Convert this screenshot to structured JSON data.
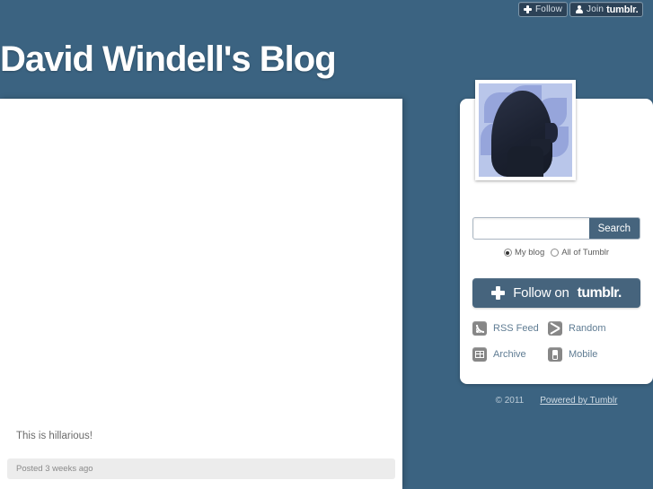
{
  "theme": {
    "background_color": "#3b6381",
    "accent_color": "#46647d",
    "panel_color": "#ffffff",
    "link_color": "#5f7c93"
  },
  "tumblr_bar": {
    "follow_button": {
      "label": "Follow",
      "icon": "plus-icon"
    },
    "join_button": {
      "label": "Join",
      "brand": "tumblr.",
      "icon": "person-icon"
    }
  },
  "header": {
    "title": "David Windell's Blog"
  },
  "main": {
    "post": {
      "photo_alt": "",
      "caption": "This is hillarious!",
      "meta": "Posted 3 weeks ago"
    }
  },
  "sidebar": {
    "avatar": {
      "icon": "avatar-head-silhouette"
    },
    "search": {
      "value": "",
      "placeholder": "",
      "button_label": "Search",
      "scopes": [
        {
          "label": "My blog",
          "checked": true
        },
        {
          "label": "All of Tumblr",
          "checked": false
        }
      ]
    },
    "follow_button": {
      "label": "Follow on",
      "brand": "tumblr.",
      "icon": "plus-icon"
    },
    "links": [
      {
        "label": "RSS Feed",
        "icon": "rss-icon"
      },
      {
        "label": "Random",
        "icon": "shuffle-icon"
      },
      {
        "label": "Archive",
        "icon": "archive-icon"
      },
      {
        "label": "Mobile",
        "icon": "mobile-icon"
      }
    ],
    "footer": {
      "copyright": "© 2011",
      "powered_by": "Powered by Tumblr"
    }
  }
}
